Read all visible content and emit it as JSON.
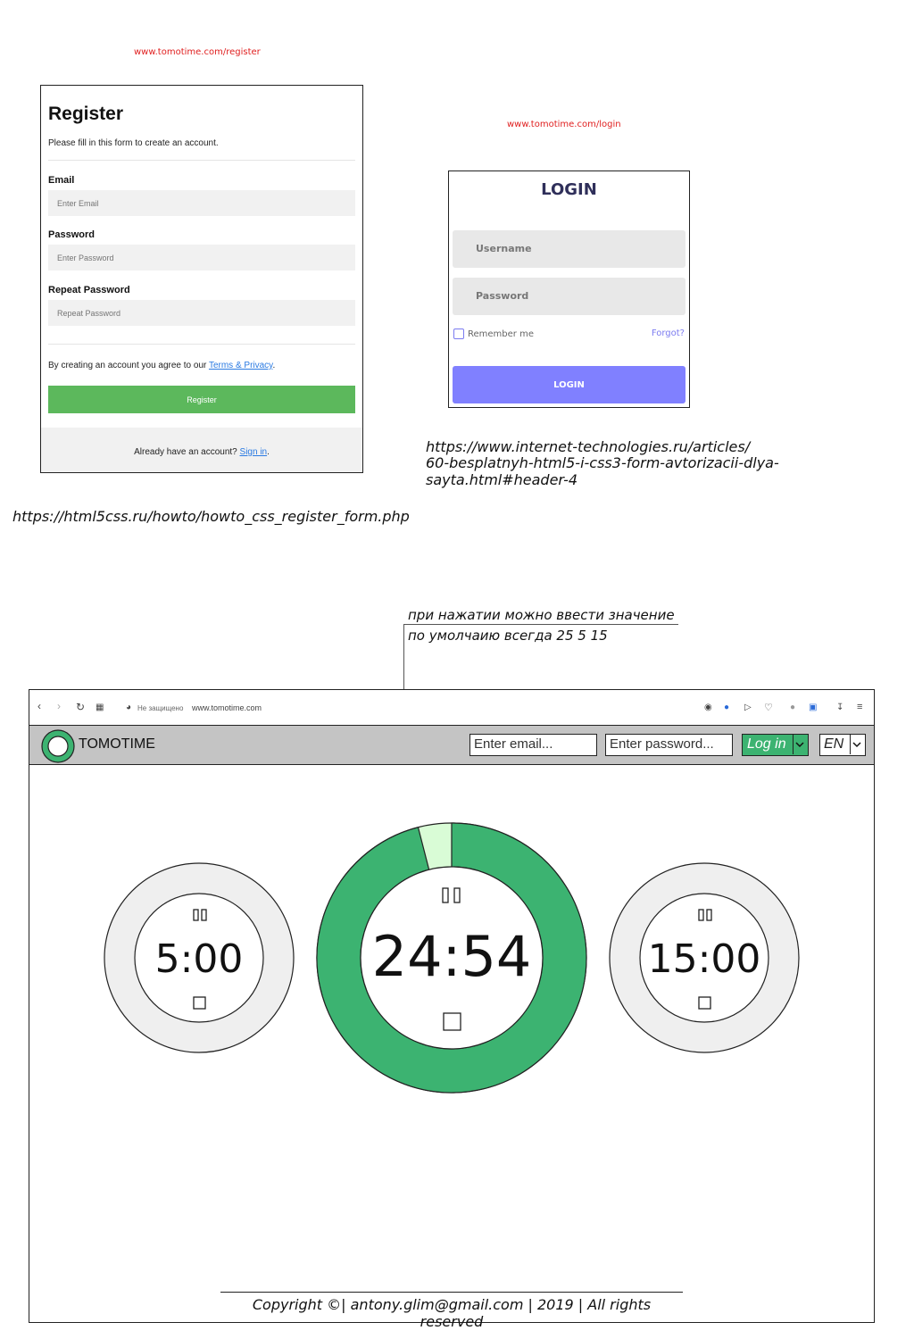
{
  "urls": {
    "register_url": "www.tomotime.com/register",
    "login_url": "www.tomotime.com/login",
    "ref_login": "https://www.internet-technologies.ru/articles/",
    "ref_login_2": "60-besplatnyh-html5-i-css3-form-avtorizacii-dlya-sayta.html#header-4",
    "ref_register": "https://html5css.ru/howto/howto_css_register_form.php"
  },
  "register": {
    "title": "Register",
    "subtitle": "Please fill in this form to create an account.",
    "email_label": "Email",
    "email_placeholder": "Enter Email",
    "password_label": "Password",
    "password_placeholder": "Enter Password",
    "repeat_label": "Repeat Password",
    "repeat_placeholder": "Repeat Password",
    "agree_text": "By creating an account you agree to our",
    "terms_link": "Terms & Privacy",
    "agree_end": ".",
    "button": "Register",
    "footer_text": "Already have an account?",
    "signin_link": "Sign in",
    "footer_end": ".",
    "button_color": "#5cb85c"
  },
  "login": {
    "title": "LOGIN",
    "username_placeholder": "Username",
    "password_placeholder": "Password",
    "remember": "Remember me",
    "forgot": "Forgot?",
    "button": "LOGIN",
    "button_color": "#8080ff"
  },
  "annotation": {
    "line1": "при нажатии можно ввести значение",
    "line2": "по умолчаию всегда 25 5 15"
  },
  "browser": {
    "insecure": "Не защищено",
    "address": "www.tomotime.com"
  },
  "app": {
    "brand": "TOMOTIME",
    "email_placeholder": "Enter email...",
    "password_placeholder": "Enter password...",
    "login_button": "Log in",
    "language": "EN",
    "accent_color": "#3cb371"
  },
  "timers": {
    "short_break": {
      "time": "5:00"
    },
    "pomodoro": {
      "time": "24:54",
      "progress_fraction": 0.96
    },
    "long_break": {
      "time": "15:00"
    }
  },
  "footer": {
    "copyright": "Copyright ©| antony.glim@gmail.com | 2019 | All rights reserved"
  }
}
